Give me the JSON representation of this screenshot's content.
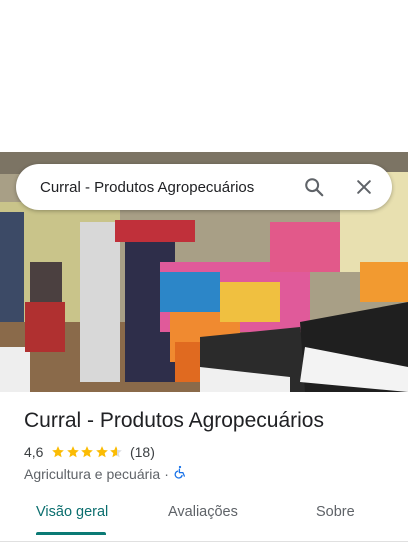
{
  "search": {
    "query": "Curral - Produtos Agropecuários"
  },
  "place": {
    "name": "Curral - Produtos Agropecuários",
    "rating": "4,6",
    "rating_value": 4.6,
    "review_count": "(18)",
    "category": "Agricultura e pecuária",
    "separator": "·"
  },
  "tabs": [
    {
      "label": "Visão geral",
      "active": true
    },
    {
      "label": "Avaliações",
      "active": false
    },
    {
      "label": "Sobre",
      "active": false
    }
  ],
  "icons": {
    "search": "search-icon",
    "close": "close-icon",
    "accessibility": "wheelchair-icon",
    "star": "star-icon"
  },
  "colors": {
    "star": "#fbbc04",
    "active_tab": "#0b7a75",
    "accessibility": "#1a73e8"
  }
}
